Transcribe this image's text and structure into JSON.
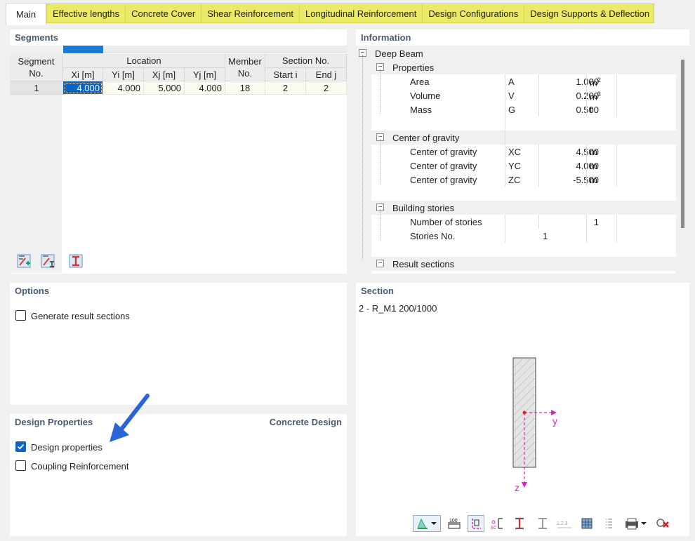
{
  "tabs": {
    "main": "Main",
    "items": [
      "Effective lengths",
      "Concrete Cover",
      "Shear Reinforcement",
      "Longitudinal Reinforcement",
      "Design Configurations",
      "Design Supports & Deflection"
    ]
  },
  "segments": {
    "title": "Segments",
    "headers": {
      "segment_no_1": "Segment",
      "segment_no_2": "No.",
      "location": "Location",
      "xi": "Xi [m]",
      "yi": "Yi [m]",
      "xj": "Xj [m]",
      "yj": "Yj [m]",
      "member_1": "Member",
      "member_2": "No.",
      "section_no": "Section No.",
      "start_i": "Start i",
      "end_j": "End j"
    },
    "rows": [
      {
        "no": "1",
        "xi": "4.000",
        "yi": "4.000",
        "xj": "5.000",
        "yj": "4.000",
        "member": "18",
        "start": "2",
        "end": "2"
      }
    ]
  },
  "information": {
    "title": "Information",
    "root": "Deep Beam",
    "groups": {
      "properties": "Properties",
      "area": {
        "label": "Area",
        "sym": "A",
        "val": "1.000",
        "unit": "m2"
      },
      "volume": {
        "label": "Volume",
        "sym": "V",
        "val": "0.200",
        "unit": "m3"
      },
      "mass": {
        "label": "Mass",
        "sym": "G",
        "val": "0.500",
        "unit": "t"
      },
      "cog": "Center of gravity",
      "xc": {
        "label": "Center of gravity",
        "sym": "XC",
        "val": "4.500",
        "unit": "m"
      },
      "yc": {
        "label": "Center of gravity",
        "sym": "YC",
        "val": "4.000",
        "unit": "m"
      },
      "zc": {
        "label": "Center of gravity",
        "sym": "ZC",
        "val": "-5.500",
        "unit": "m"
      },
      "stories": "Building stories",
      "num_stories": {
        "label": "Number of stories",
        "val": "1"
      },
      "stories_no": {
        "label": "Stories No.",
        "val": "1"
      },
      "result_sections": "Result sections"
    }
  },
  "options": {
    "title": "Options",
    "generate_result_sections": "Generate result sections"
  },
  "design_properties": {
    "title": "Design Properties",
    "right_title": "Concrete Design",
    "design_properties": "Design properties",
    "coupling": "Coupling Reinforcement"
  },
  "section": {
    "title": "Section",
    "name": "2 - R_M1 200/1000",
    "axis_y": "y",
    "axis_z": "z",
    "toolbar_text": "100",
    "numbering_text": "1 2 3"
  },
  "colors": {
    "accent": "#0a63c6",
    "tab_highlight": "#e9ea68",
    "axis": "#e020c0",
    "arrow": "#2b63d8"
  }
}
